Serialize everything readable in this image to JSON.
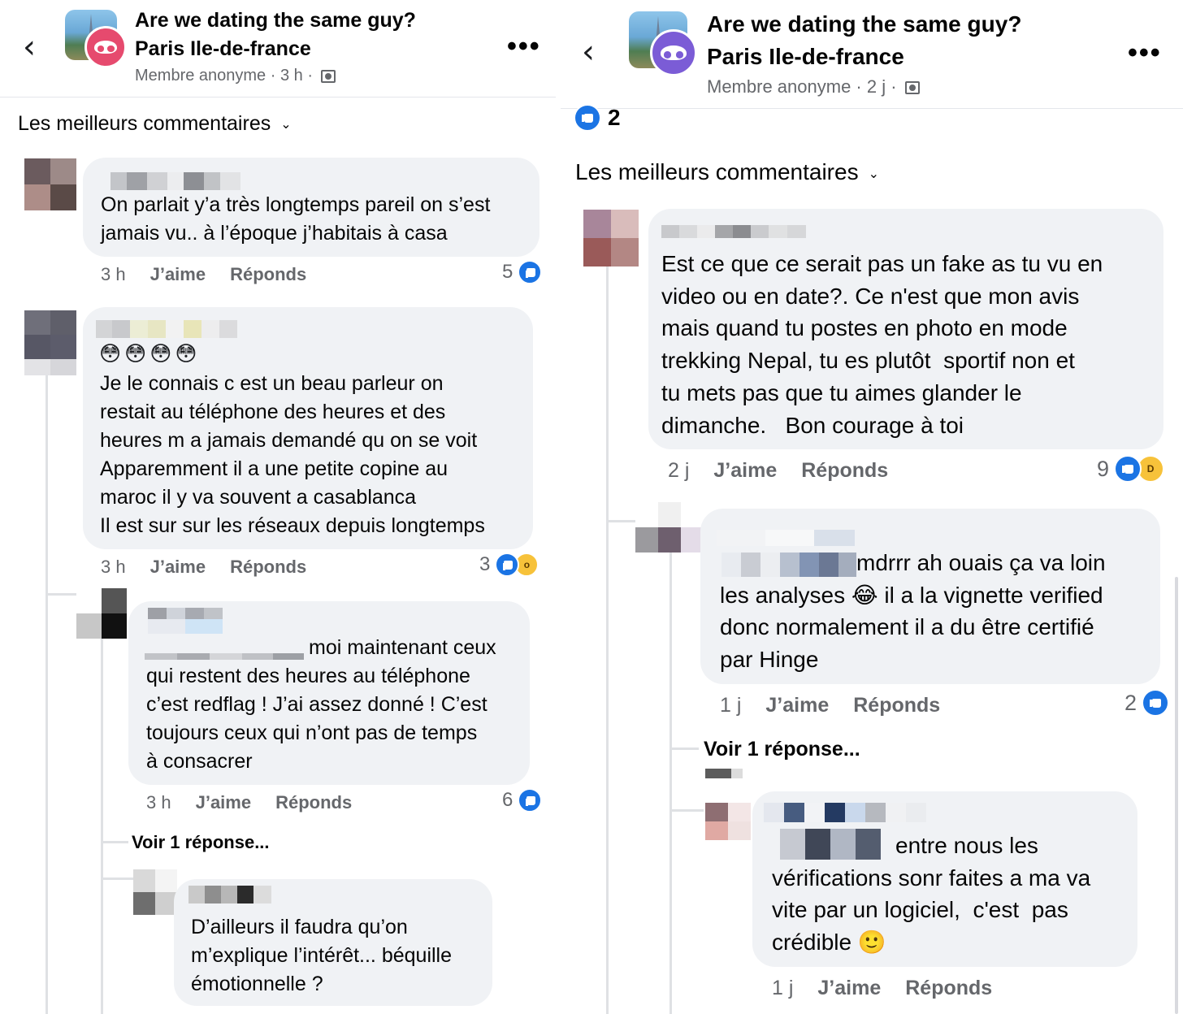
{
  "left": {
    "header": {
      "back_icon": "chevron-left-icon",
      "group_name": "Are we dating the same guy?",
      "group_city": "Paris Ile-de-france",
      "author": "Membre anonyme",
      "time": "3 h",
      "privacy_icon": "group-members-icon",
      "more_label": "•••",
      "anon_color": "#e64a6e"
    },
    "sort_label": "Les meilleurs commentaires",
    "comments": [
      {
        "text": "On parlait y’a très longtemps pareil on s’est\njamais vu.. à l’époque j’habitais à casa",
        "time": "3 h",
        "like": "J’aime",
        "reply": "Réponds",
        "reactions": "5"
      },
      {
        "emojis": "😳😳😳😳",
        "text": "Je le connais c est un beau parleur on\nrestait au téléphone des heures et des\nheures m a jamais demandé qu on se voit\nApparemment il a une petite copine au\nmaroc il y va souvent a casablanca\nIl est sur sur les réseaux depuis longtemps",
        "time": "3 h",
        "like": "J’aime",
        "reply": "Réponds",
        "reactions": "3"
      },
      {
        "text": "moi maintenant ceux\nqui restent des heures au téléphone\nc’est redflag ! J’ai assez donné ! C’est\ntoujours ceux qui n’ont pas de temps\nà consacrer",
        "time": "3 h",
        "like": "J’aime",
        "reply": "Réponds",
        "reactions": "6"
      },
      {
        "text": "D’ailleurs il faudra qu’on\nm’explique l’intérêt... béquille\némotionnelle ?"
      }
    ],
    "see_reply": "Voir 1 réponse..."
  },
  "right": {
    "header": {
      "back_icon": "chevron-left-icon",
      "group_name": "Are we dating the same guy?",
      "group_city": "Paris Ile-de-france",
      "author": "Membre anonyme",
      "time": "2 j",
      "privacy_icon": "group-members-icon",
      "more_label": "•••",
      "anon_color": "#7b5cd6"
    },
    "post_reactions": "2",
    "sort_label": "Les meilleurs commentaires",
    "comments": [
      {
        "text": "Est ce que ce serait pas un fake as tu vu en\nvideo ou en date?. Ce n'est que mon avis\nmais quand tu postes en photo en mode\ntrekking Nepal, tu es plutôt  sportif non et\ntu mets pas que tu aimes glander le\ndimanche.   Bon courage à toi",
        "time": "2 j",
        "like": "J’aime",
        "reply": "Réponds",
        "reactions": "9"
      },
      {
        "text": "mdrrr ah ouais ça va loin\nles analyses 😂 il a la vignette verified\ndonc normalement il a du être certifié\npar Hinge",
        "time": "1 j",
        "like": "J’aime",
        "reply": "Réponds",
        "reactions": "2"
      },
      {
        "text": "entre nous les\nvérifications sonr faites a ma va\nvite par un logiciel,  c'est  pas\ncrédible 🙂",
        "time": "1 j",
        "like": "J’aime",
        "reply": "Réponds"
      }
    ],
    "see_reply": "Voir 1 réponse..."
  }
}
